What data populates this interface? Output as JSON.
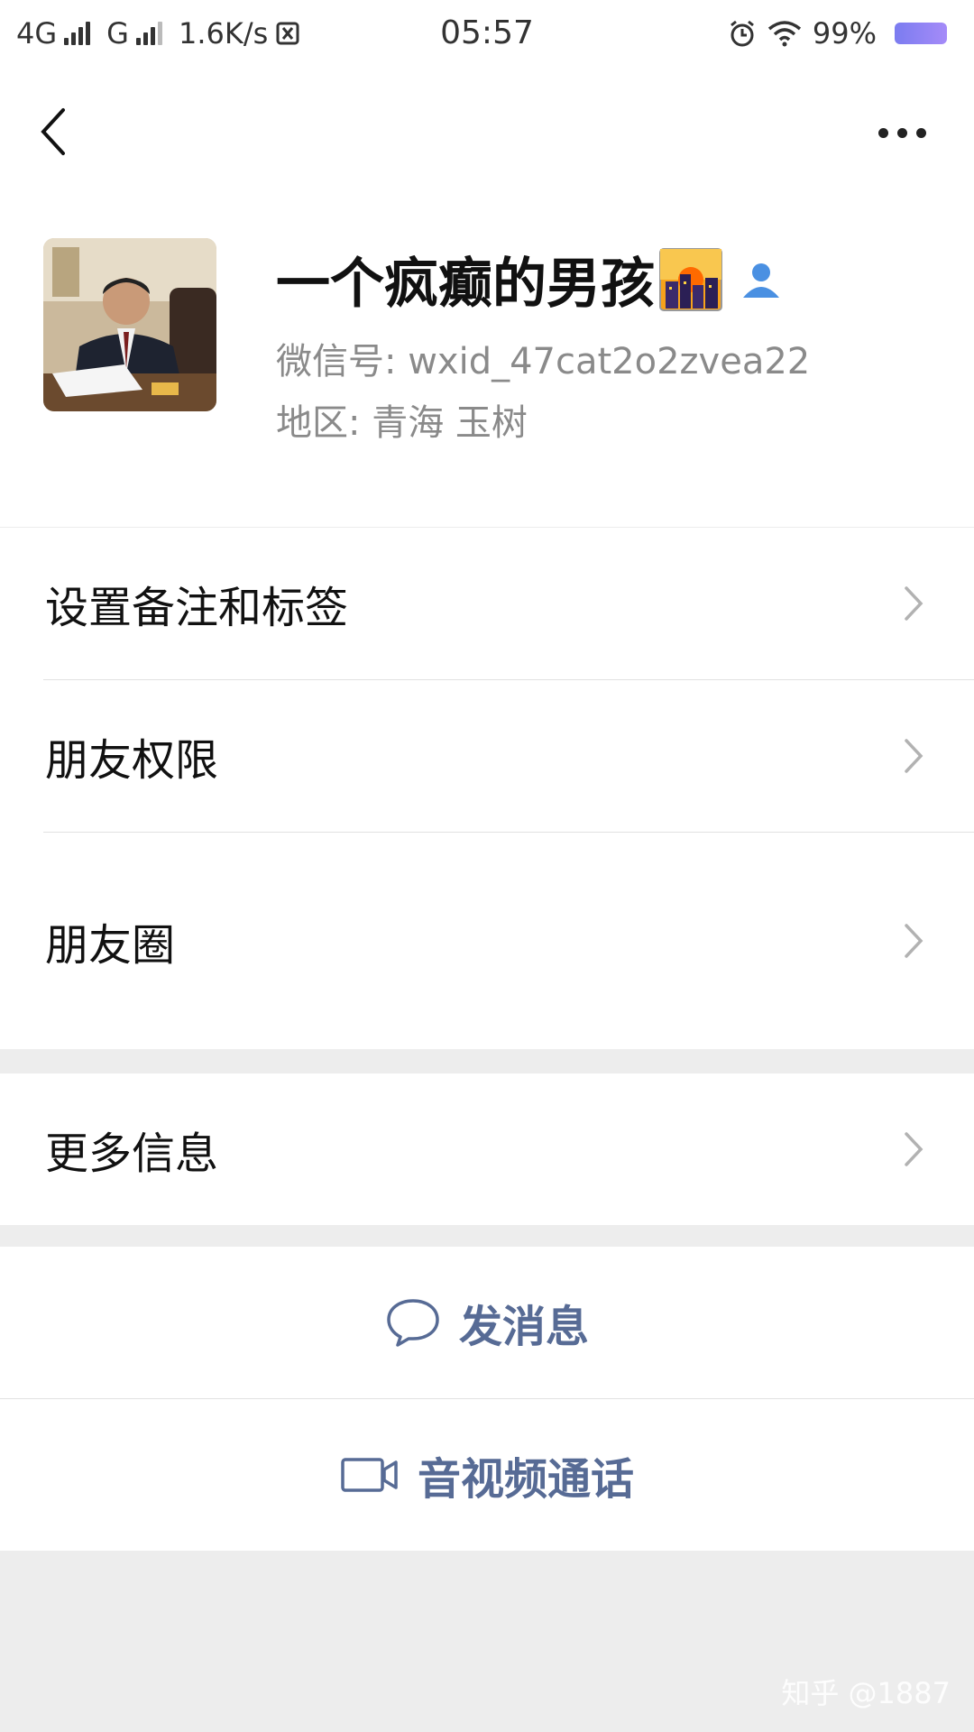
{
  "status_bar": {
    "network1": "4G",
    "network2": "G",
    "speed": "1.6K/s",
    "time": "05:57",
    "battery": "99%",
    "icons": [
      "signal-icon",
      "nfc-icon",
      "alarm-icon",
      "wifi-icon",
      "battery-icon"
    ]
  },
  "navbar": {
    "back_icon": "chevron-left-icon",
    "more_icon": "more-dots-icon"
  },
  "profile": {
    "name": "一个疯癫的男孩",
    "name_emoji": "sunset-city-emoji",
    "contact_icon": "person-icon",
    "wechat_id": "微信号: wxid_47cat2o2zvea22",
    "region": "地区: 青海  玉树"
  },
  "menu": {
    "items": [
      {
        "label": "设置备注和标签"
      },
      {
        "label": "朋友权限"
      },
      {
        "label": "朋友圈"
      }
    ],
    "more_info": "更多信息"
  },
  "actions": {
    "message": "发消息",
    "call": "音视频通话"
  },
  "watermark": "知乎 @1887",
  "colors": {
    "link_blue": "#576b95",
    "background": "#ededed",
    "secondary_text": "#8a8a8a"
  }
}
